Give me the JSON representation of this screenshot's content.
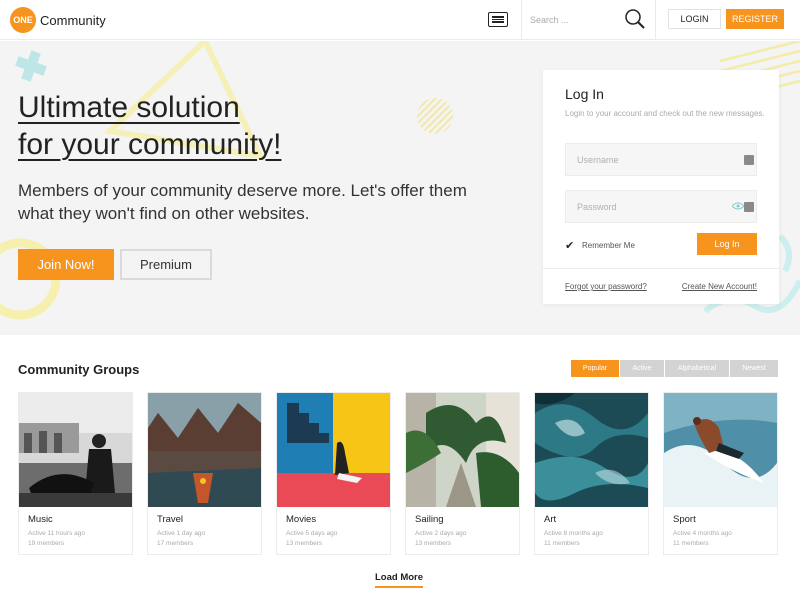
{
  "header": {
    "logo_badge": "ONE",
    "logo_text": "Community",
    "menu_icon": "hamburger-icon",
    "search_placeholder": "Search ...",
    "search_icon": "search-icon",
    "login_label": "LOGIN",
    "register_label": "REGISTER"
  },
  "hero": {
    "title_line1": "Ultimate solution",
    "title_line2": "for your community!",
    "subtitle": "Members of your community deserve more. Let's offer them what they won't find on other websites.",
    "join_label": "Join Now!",
    "premium_label": "Premium"
  },
  "login": {
    "title": "Log In",
    "description": "Login to your account and check out the new messages.",
    "username_placeholder": "Username",
    "password_placeholder": "Password",
    "remember_label": "Remember Me",
    "remember_checked": true,
    "login_button": "Log In",
    "forgot_link": "Forgot your password?",
    "create_link": "Create New Account!"
  },
  "groups": {
    "title": "Community Groups",
    "filters": [
      {
        "label": "Popular",
        "active": true
      },
      {
        "label": "Active",
        "active": false
      },
      {
        "label": "Alphabetical",
        "active": false
      },
      {
        "label": "Newest",
        "active": false
      }
    ],
    "items": [
      {
        "name": "Music",
        "active": "Active 11 hours ago",
        "members": "19 members"
      },
      {
        "name": "Travel",
        "active": "Active 1 day ago",
        "members": "17 members"
      },
      {
        "name": "Movies",
        "active": "Active 5 days ago",
        "members": "13 members"
      },
      {
        "name": "Sailing",
        "active": "Active 2 days ago",
        "members": "13 members"
      },
      {
        "name": "Art",
        "active": "Active 8 months ago",
        "members": "11 members"
      },
      {
        "name": "Sport",
        "active": "Active 4 months ago",
        "members": "11 members"
      }
    ],
    "load_more": "Load More"
  },
  "colors": {
    "accent": "#f7941d",
    "hero_bg": "#f4f4f4",
    "filter_inactive": "#d3d3d3"
  }
}
